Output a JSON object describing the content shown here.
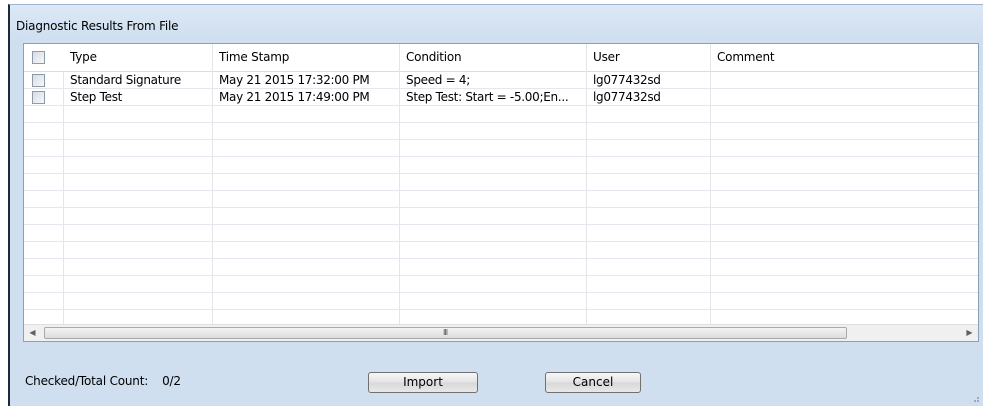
{
  "window": {
    "title": "Diagnostic Results From File"
  },
  "grid": {
    "columns": [
      "Type",
      "Time Stamp",
      "Condition",
      "User",
      "Comment"
    ],
    "rows": [
      {
        "type": "Standard Signature",
        "time_stamp": "May 21 2015 17:32:00 PM",
        "condition": "Speed = 4;",
        "user": "lg077432sd",
        "comment": ""
      },
      {
        "type": "Step Test",
        "time_stamp": "May 21 2015 17:49:00 PM",
        "condition": "Step Test:  Start = -5.00;En...",
        "user": "lg077432sd",
        "comment": ""
      }
    ],
    "scroll_grip": "III"
  },
  "footer": {
    "count_label": "Checked/Total Count:",
    "count_value": "0/2",
    "import_label": "Import",
    "cancel_label": "Cancel"
  }
}
